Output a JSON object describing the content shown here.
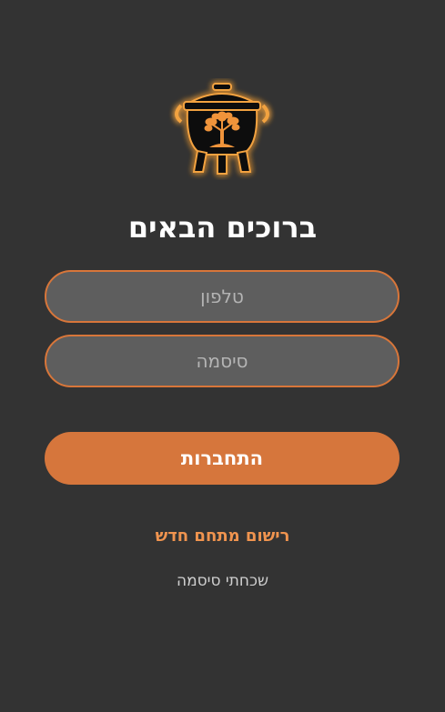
{
  "login": {
    "title": "ברוכים הבאים",
    "phone_placeholder": "טלפון",
    "phone_value": "",
    "password_placeholder": "סיסמה",
    "password_value": "",
    "login_label": "התחברות",
    "register_label": "רישום מתחם חדש",
    "forgot_label": "שכחתי סיסמה"
  },
  "logo": {
    "icon": "cauldron-tree-icon"
  },
  "colors": {
    "background": "#333333",
    "accent": "#d6763c",
    "link": "#f0944f",
    "field_fill": "#5e5e5e",
    "text": "#ffffff"
  }
}
